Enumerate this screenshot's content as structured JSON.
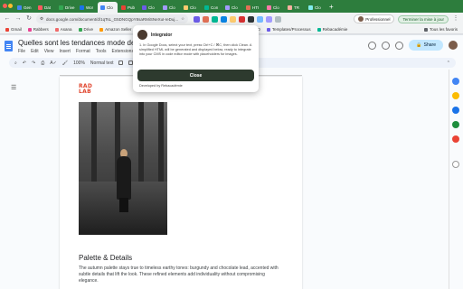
{
  "browser": {
    "tabs": [
      {
        "label": "Gen",
        "favicon_color": "#4285f4"
      },
      {
        "label": "Dat",
        "favicon_color": "#ff5a5f"
      },
      {
        "label": "Drive",
        "favicon_color": "#34a853"
      },
      {
        "label": "Wor",
        "favicon_color": "#1a73e8"
      },
      {
        "label": "Clo",
        "favicon_color": "#4285f4",
        "active": true
      },
      {
        "label": "Pub",
        "favicon_color": "#ea4335"
      },
      {
        "label": "Clo",
        "favicon_color": "#6c5ce7"
      },
      {
        "label": "Clo",
        "favicon_color": "#a29bfe"
      },
      {
        "label": "Clo",
        "favicon_color": "#fdcb6e"
      },
      {
        "label": "Con",
        "favicon_color": "#00b894"
      },
      {
        "label": "Clo",
        "favicon_color": "#a29bfe"
      },
      {
        "label": "HTI",
        "favicon_color": "#e17055"
      },
      {
        "label": "Clo",
        "favicon_color": "#fd79a8"
      },
      {
        "label": "TR",
        "favicon_color": "#fab1a0"
      },
      {
        "label": "Clo",
        "favicon_color": "#81ecec"
      }
    ],
    "new_tab_label": "+",
    "url": "docs.google.com/document/d/1qTsL_G5DNGQpY8saRMiSNeXuI-IeDuj...",
    "profile_label": "Professionnel",
    "finish_label": "Terminer la mise à jour",
    "bookmarks": [
      {
        "label": "Gmail",
        "color": "#ea4335"
      },
      {
        "label": "Rabbers",
        "color": "#e84393"
      },
      {
        "label": "Asana",
        "color": "#f06a6a"
      },
      {
        "label": "Drive",
        "color": "#34a853"
      },
      {
        "label": "Amazon Seller",
        "color": "#ff9900"
      },
      {
        "label": "SEO",
        "color": "#1a73e8"
      },
      {
        "label": "Templates/Processus",
        "color": "#6c5ce7"
      },
      {
        "label": "Rebacadémie",
        "color": "#00b894"
      }
    ],
    "all_bookmarks_label": "Tous les favoris"
  },
  "docs": {
    "title": "Quelles sont les tendances mode de l'automne",
    "menu": [
      "File",
      "Edit",
      "View",
      "Insert",
      "Format",
      "Tools",
      "Extensions"
    ],
    "zoom": "100%",
    "style_select": "Normal text",
    "share_label": "Share"
  },
  "document": {
    "brand_logo_line1": "RAD",
    "brand_logo_line2": "LAB",
    "section_heading": "Palette & Details",
    "body_text": "The autumn palette stays true to timeless earthy tones: burgundy and chocolate lead, accented with subtle details that lift the look. These refined elements add individuality without compromising elegance."
  },
  "popup": {
    "title": "Integrator",
    "description": "1. In Google Docs, select your text, press Ctrl+C / ⌘C, then click Clean. A simplified HTML will be generated and displayed below, ready to integrate into your CMS in code editor mode with placeholders for images.",
    "close_label": "Close",
    "footer": "Developed by Rebacadémie"
  },
  "colors": {
    "chrome_green": "#2d7d3d",
    "popup_button": "#2d3a2e",
    "brand_red": "#e0452e",
    "share_button": "#c2e7ff"
  }
}
